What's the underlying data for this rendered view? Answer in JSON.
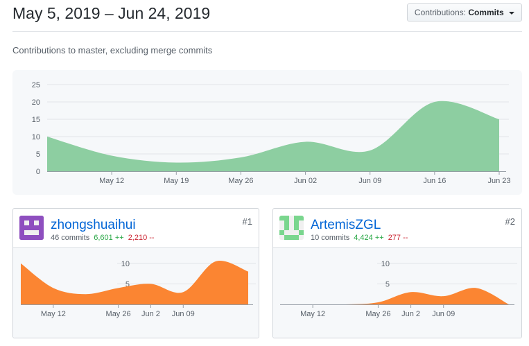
{
  "header": {
    "title": "May 5, 2019 – Jun 24, 2019",
    "contributions_button": {
      "prefix": "Contributions:",
      "selected": "Commits"
    }
  },
  "subtitle": "Contributions to master, excluding merge commits",
  "colors": {
    "main_area": "#8dcea1",
    "user_area": "#fb8532",
    "link": "#0366d6",
    "additions": "#28a745",
    "deletions": "#cb2431"
  },
  "contributors": [
    {
      "username": "zhongshuaihui",
      "commits": "46 commits",
      "additions": "6,601 ++",
      "deletions": "2,210 --",
      "rank": "#1",
      "avatar_icon": "identicon-purple"
    },
    {
      "username": "ArtemisZGL",
      "commits": "10 commits",
      "additions": "4,424 ++",
      "deletions": "277 --",
      "rank": "#2",
      "avatar_icon": "identicon-green"
    }
  ],
  "chart_data": [
    {
      "type": "area",
      "title": "",
      "x": [
        "2019-05-05",
        "2019-05-12",
        "2019-05-19",
        "2019-05-26",
        "2019-06-02",
        "2019-06-09",
        "2019-06-16",
        "2019-06-23"
      ],
      "series": [
        {
          "values": [
            10,
            4.5,
            2.5,
            4,
            8.5,
            6,
            20,
            15
          ]
        }
      ],
      "x_ticks": [
        "May 12",
        "May 19",
        "May 26",
        "Jun 02",
        "Jun 09",
        "Jun 16",
        "Jun 23"
      ],
      "y_ticks": [
        "0",
        "5",
        "10",
        "15",
        "20",
        "25"
      ],
      "ylim": [
        0,
        25
      ],
      "grid": true
    },
    {
      "type": "area",
      "title": "",
      "x": [
        "2019-05-05",
        "2019-05-12",
        "2019-05-19",
        "2019-05-26",
        "2019-06-02",
        "2019-06-09",
        "2019-06-16",
        "2019-06-23"
      ],
      "series": [
        {
          "values": [
            10,
            4,
            2.5,
            4,
            5,
            3,
            10.5,
            8
          ]
        }
      ],
      "x_ticks": [
        "May 12",
        "May 26",
        "Jun 09",
        "Jun 2"
      ],
      "y_ticks": [
        "5",
        "10"
      ],
      "ylim": [
        0,
        12
      ],
      "grid": true
    },
    {
      "type": "area",
      "title": "",
      "x": [
        "2019-05-05",
        "2019-05-12",
        "2019-05-19",
        "2019-05-26",
        "2019-06-02",
        "2019-06-09",
        "2019-06-16",
        "2019-06-23"
      ],
      "series": [
        {
          "values": [
            0,
            0,
            0,
            0.5,
            3,
            2,
            4,
            0
          ]
        }
      ],
      "x_ticks": [
        "May 12",
        "May 26",
        "Jun 09",
        "Jun 2"
      ],
      "y_ticks": [
        "5",
        "10"
      ],
      "ylim": [
        0,
        12
      ],
      "grid": true
    }
  ]
}
